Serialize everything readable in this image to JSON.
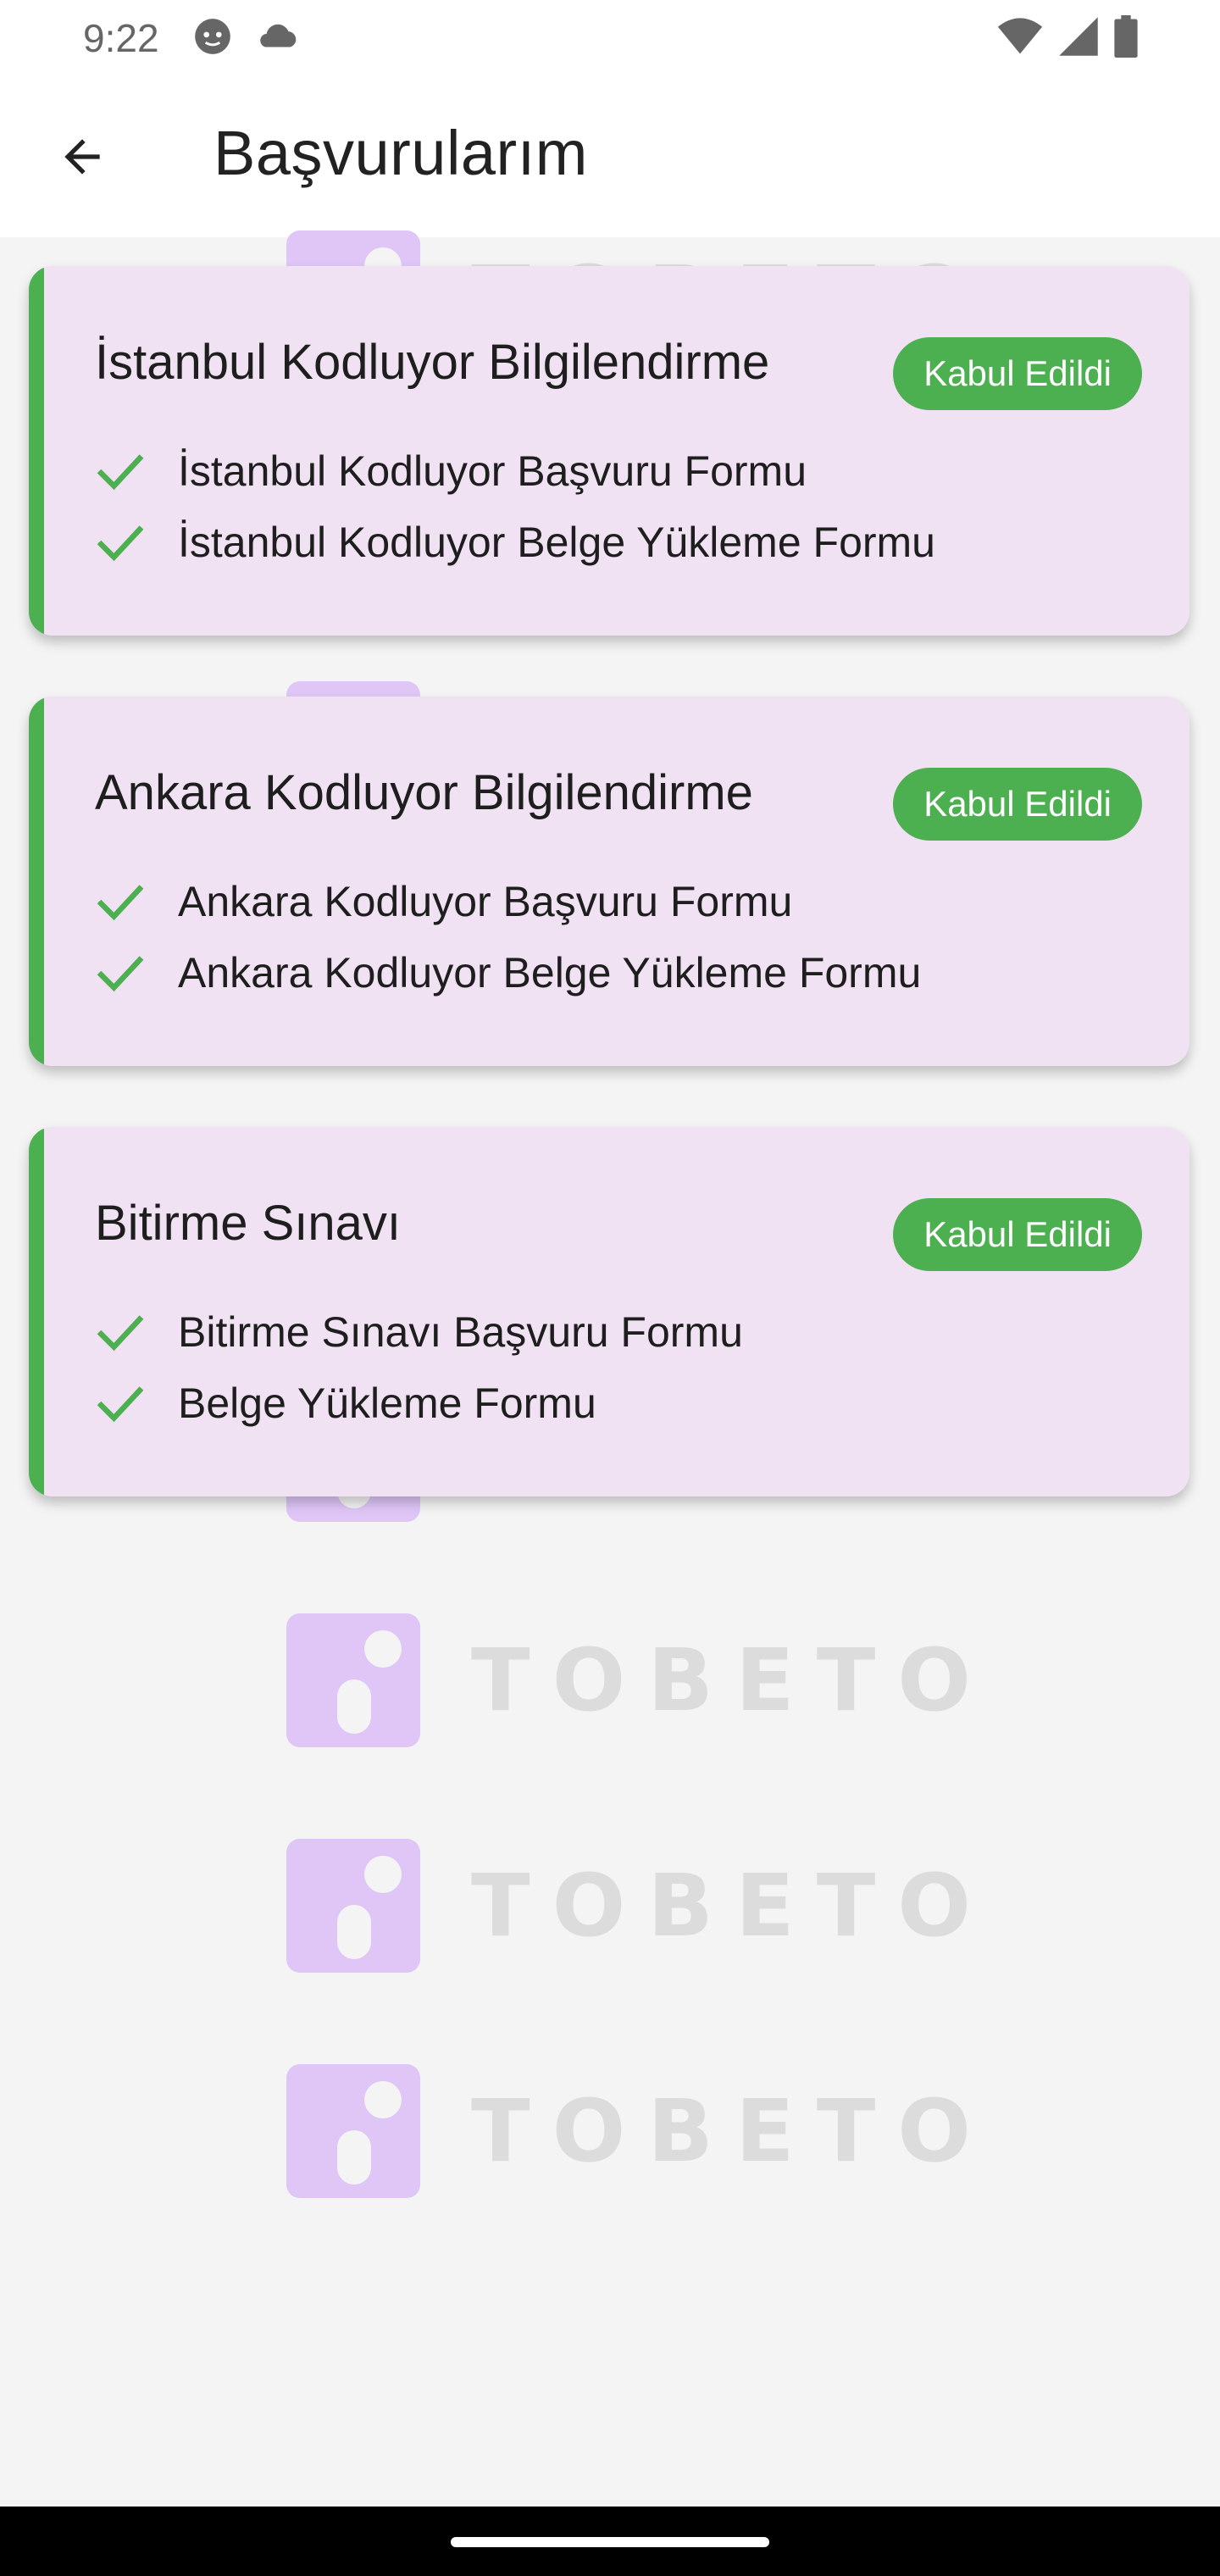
{
  "status_bar": {
    "time": "9:22",
    "icons": [
      "face-icon",
      "cloud-icon",
      "wifi-icon",
      "signal-icon",
      "battery-icon"
    ]
  },
  "header": {
    "title": "Başvurularım",
    "back_icon": "arrow-left-icon"
  },
  "watermark": {
    "text": "TOBETO",
    "color": "#dfc6f7"
  },
  "applications": [
    {
      "title": "İstanbul Kodluyor Bilgilendirme",
      "status": "Kabul Edildi",
      "forms": [
        "İstanbul Kodluyor Başvuru Formu",
        "İstanbul Kodluyor Belge Yükleme Formu"
      ]
    },
    {
      "title": "Ankara Kodluyor Bilgilendirme",
      "status": "Kabul Edildi",
      "forms": [
        "Ankara Kodluyor Başvuru Formu",
        "Ankara Kodluyor Belge Yükleme Formu"
      ]
    },
    {
      "title": "Bitirme Sınavı",
      "status": "Kabul Edildi",
      "forms": [
        "Bitirme Sınavı Başvuru Formu",
        "Belge Yükleme Formu"
      ]
    }
  ],
  "colors": {
    "accent": "#4caf50",
    "card_background": "#f0e2f3",
    "page_background": "#f4f4f4"
  }
}
